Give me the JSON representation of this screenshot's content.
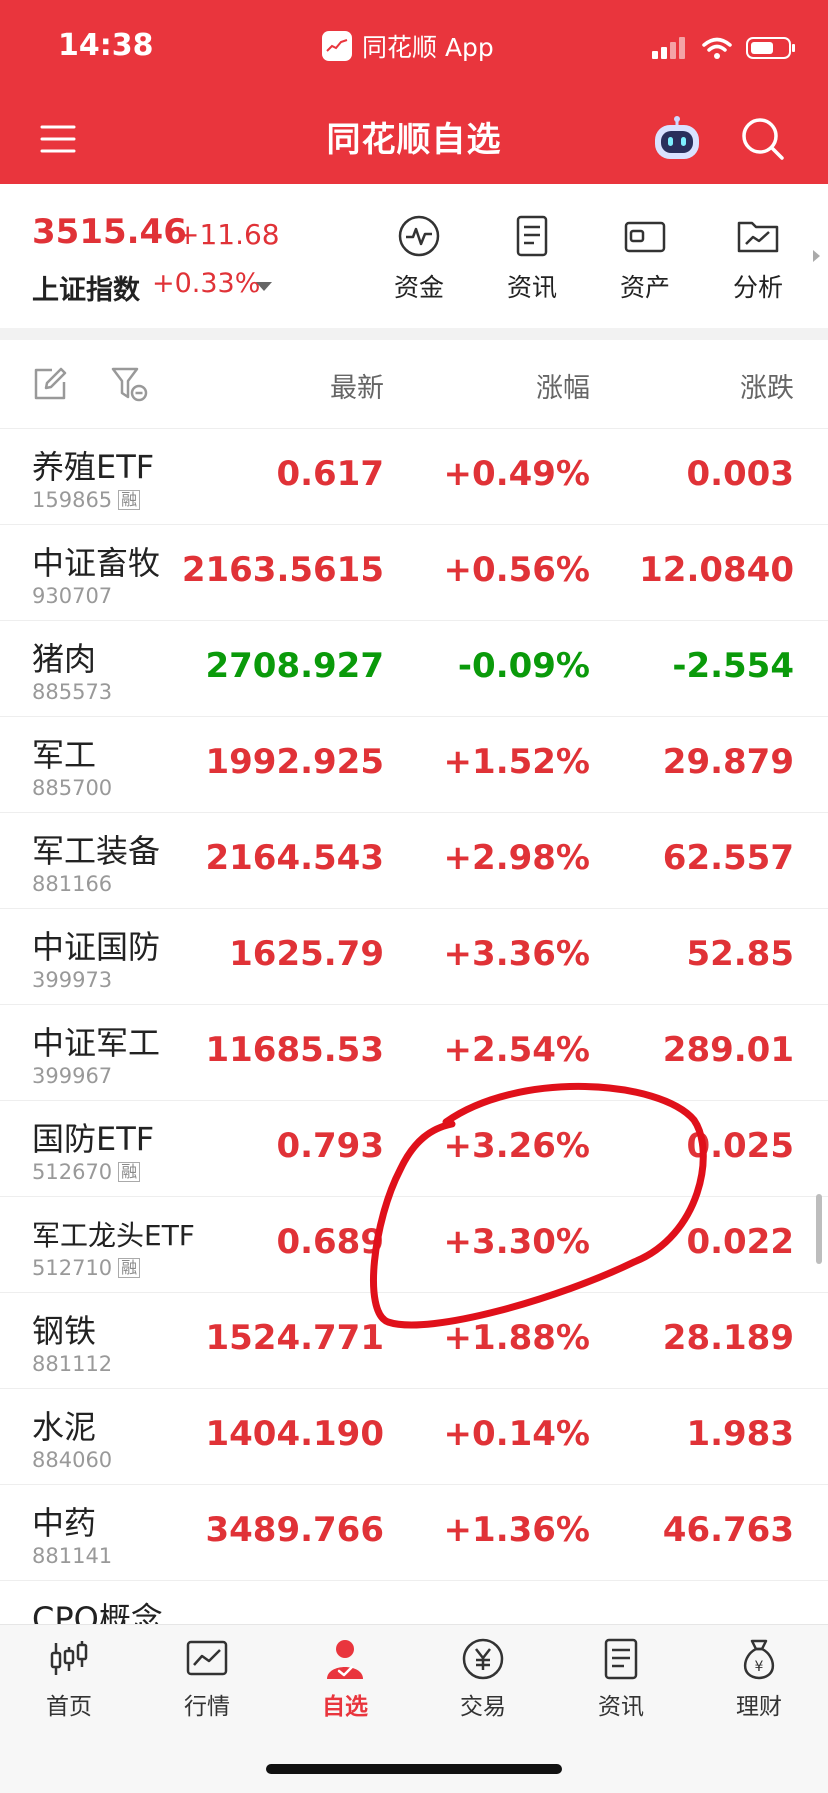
{
  "status_bar": {
    "time": "14:38",
    "app_name": "同花顺 App"
  },
  "header": {
    "title": "同花顺自选"
  },
  "index": {
    "value": "3515.46",
    "change": "+11.68",
    "name": "上证指数",
    "pct": "+0.33%"
  },
  "quick_actions": [
    {
      "label": "资金",
      "icon": "pulse-icon"
    },
    {
      "label": "资讯",
      "icon": "document-icon"
    },
    {
      "label": "资产",
      "icon": "wallet-icon"
    },
    {
      "label": "分析",
      "icon": "chart-folder-icon"
    }
  ],
  "columns": {
    "latest": "最新",
    "pct_change": "涨幅",
    "change": "涨跌"
  },
  "rows": [
    {
      "name": "养殖ETF",
      "code": "159865",
      "margin": "融",
      "price": "0.617",
      "pct": "+0.49%",
      "chg": "0.003",
      "dir": "up"
    },
    {
      "name": "中证畜牧",
      "code": "930707",
      "margin": "",
      "price": "2163.5615",
      "pct": "+0.56%",
      "chg": "12.0840",
      "dir": "up"
    },
    {
      "name": "猪肉",
      "code": "885573",
      "margin": "",
      "price": "2708.927",
      "pct": "-0.09%",
      "chg": "-2.554",
      "dir": "down"
    },
    {
      "name": "军工",
      "code": "885700",
      "margin": "",
      "price": "1992.925",
      "pct": "+1.52%",
      "chg": "29.879",
      "dir": "up"
    },
    {
      "name": "军工装备",
      "code": "881166",
      "margin": "",
      "price": "2164.543",
      "pct": "+2.98%",
      "chg": "62.557",
      "dir": "up"
    },
    {
      "name": "中证国防",
      "code": "399973",
      "margin": "",
      "price": "1625.79",
      "pct": "+3.36%",
      "chg": "52.85",
      "dir": "up"
    },
    {
      "name": "中证军工",
      "code": "399967",
      "margin": "",
      "price": "11685.53",
      "pct": "+2.54%",
      "chg": "289.01",
      "dir": "up"
    },
    {
      "name": "国防ETF",
      "code": "512670",
      "margin": "融",
      "price": "0.793",
      "pct": "+3.26%",
      "chg": "0.025",
      "dir": "up"
    },
    {
      "name": "军工龙头ETF",
      "code": "512710",
      "margin": "融",
      "price": "0.689",
      "pct": "+3.30%",
      "chg": "0.022",
      "dir": "up"
    },
    {
      "name": "钢铁",
      "code": "881112",
      "margin": "",
      "price": "1524.771",
      "pct": "+1.88%",
      "chg": "28.189",
      "dir": "up"
    },
    {
      "name": "水泥",
      "code": "884060",
      "margin": "",
      "price": "1404.190",
      "pct": "+0.14%",
      "chg": "1.983",
      "dir": "up"
    },
    {
      "name": "中药",
      "code": "881141",
      "margin": "",
      "price": "3489.766",
      "pct": "+1.36%",
      "chg": "46.763",
      "dir": "up"
    },
    {
      "name": "CPO概念",
      "code": "",
      "margin": "",
      "price": "",
      "pct": "",
      "chg": "",
      "dir": "up"
    }
  ],
  "tabs": [
    {
      "label": "首页",
      "icon": "candlestick-icon"
    },
    {
      "label": "行情",
      "icon": "market-chart-icon"
    },
    {
      "label": "自选",
      "icon": "person-check-icon"
    },
    {
      "label": "交易",
      "icon": "yuan-coin-icon"
    },
    {
      "label": "资讯",
      "icon": "news-icon"
    },
    {
      "label": "理财",
      "icon": "money-bag-icon"
    }
  ],
  "active_tab": "自选",
  "colors": {
    "brand_red": "#e9353d",
    "up_red": "#e03237",
    "down_green": "#0a9a0a",
    "annotation_red": "#e0101a"
  }
}
